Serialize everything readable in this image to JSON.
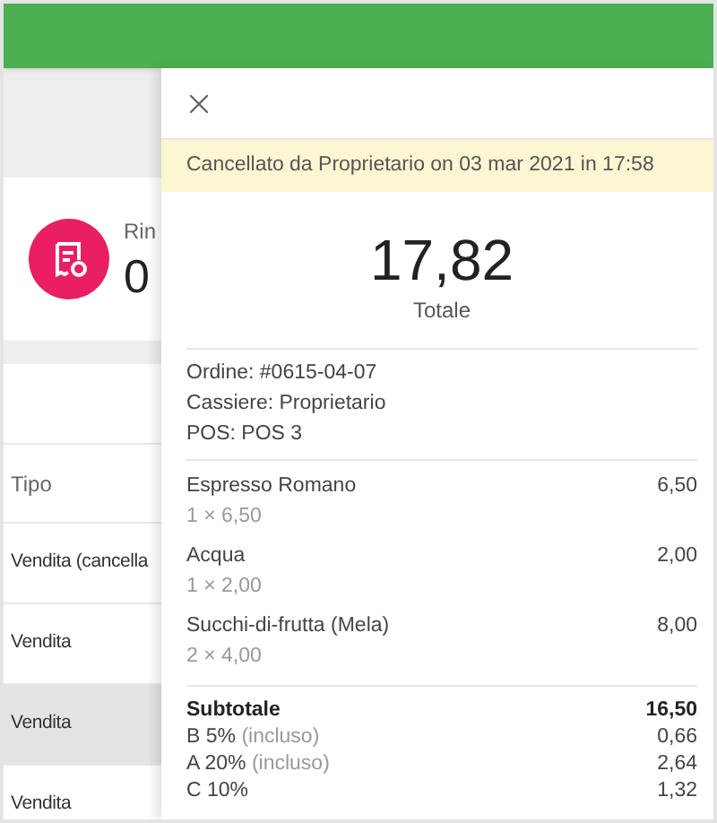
{
  "stat_card": {
    "label": "Rin",
    "value": "0"
  },
  "table": {
    "column_header": "Tipo",
    "rows": [
      {
        "type": "Vendita (cancella",
        "selected": false
      },
      {
        "type": "Vendita",
        "selected": false
      },
      {
        "type": "Vendita",
        "selected": true
      },
      {
        "type": "Vendita",
        "selected": false
      }
    ]
  },
  "receipt": {
    "banner": "Cancellato da Proprietario on 03 mar 2021 in 17:58",
    "total": "17,82",
    "total_label": "Totale",
    "info": [
      "Ordine: #0615-04-07",
      "Cassiere: Proprietario",
      "POS: POS 3"
    ],
    "items": [
      {
        "name": "Espresso Romano",
        "detail": "1 × 6,50",
        "amount": "6,50"
      },
      {
        "name": "Acqua",
        "detail": "1 × 2,00",
        "amount": "2,00"
      },
      {
        "name": "Succhi-di-frutta (Mela)",
        "detail": "2 × 4,00",
        "amount": "8,00"
      }
    ],
    "summary": [
      {
        "kind": "subtotal",
        "label": "Subtotale",
        "amount": "16,50"
      },
      {
        "kind": "tax",
        "label": "B 5%",
        "note": "(incluso)",
        "amount": "0,66"
      },
      {
        "kind": "tax",
        "label": "A 20%",
        "note": "(incluso)",
        "amount": "2,64"
      },
      {
        "kind": "tax",
        "label": "C 10%",
        "amount": "1,32"
      }
    ]
  }
}
